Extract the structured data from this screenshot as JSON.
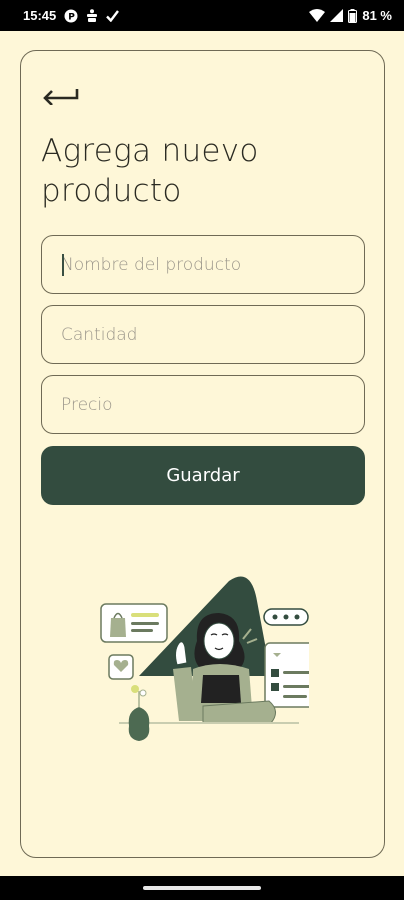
{
  "status": {
    "time": "15:45",
    "battery": "81 %",
    "icons": [
      "p-icon",
      "accessibility-icon",
      "check-icon",
      "wifi-icon",
      "signal-icon",
      "battery-icon"
    ]
  },
  "form": {
    "back_icon": "back-arrow-icon",
    "title": "Agrega nuevo producto",
    "name_placeholder": "Nombre del producto",
    "quantity_placeholder": "Cantidad",
    "price_placeholder": "Precio",
    "save_label": "Guardar"
  },
  "colors": {
    "background": "#fef7d8",
    "accent": "#334c3f",
    "border": "#6f6a55",
    "sage": "#a5b08f"
  }
}
